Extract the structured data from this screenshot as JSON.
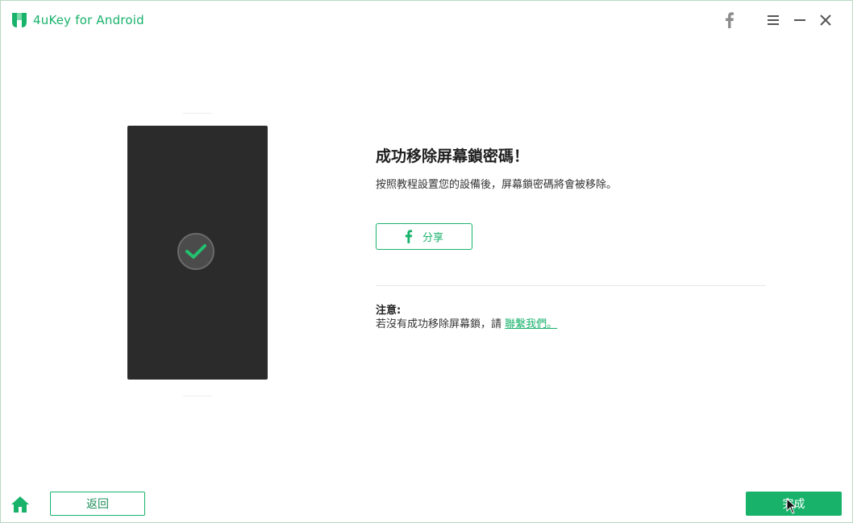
{
  "app": {
    "title": "4uKey for Android",
    "accent_color": "#18b26b",
    "icons": {
      "logo": "4ukey-logo-icon",
      "facebook": "facebook-icon",
      "menu": "hamburger-menu-icon",
      "minimize": "minimize-icon",
      "close": "close-icon",
      "home": "home-icon",
      "check": "check-icon"
    }
  },
  "content": {
    "heading": "成功移除屏幕鎖密碼！",
    "subtext": "按照教程設置您的設備後，屏幕鎖密碼將會被移除。",
    "share_label": "分享",
    "note_title": "注意:",
    "note_text": "若沒有成功移除屏幕鎖，請 ",
    "note_link": "聯繫我們。"
  },
  "footer": {
    "back_label": "返回",
    "done_label": "完成"
  }
}
